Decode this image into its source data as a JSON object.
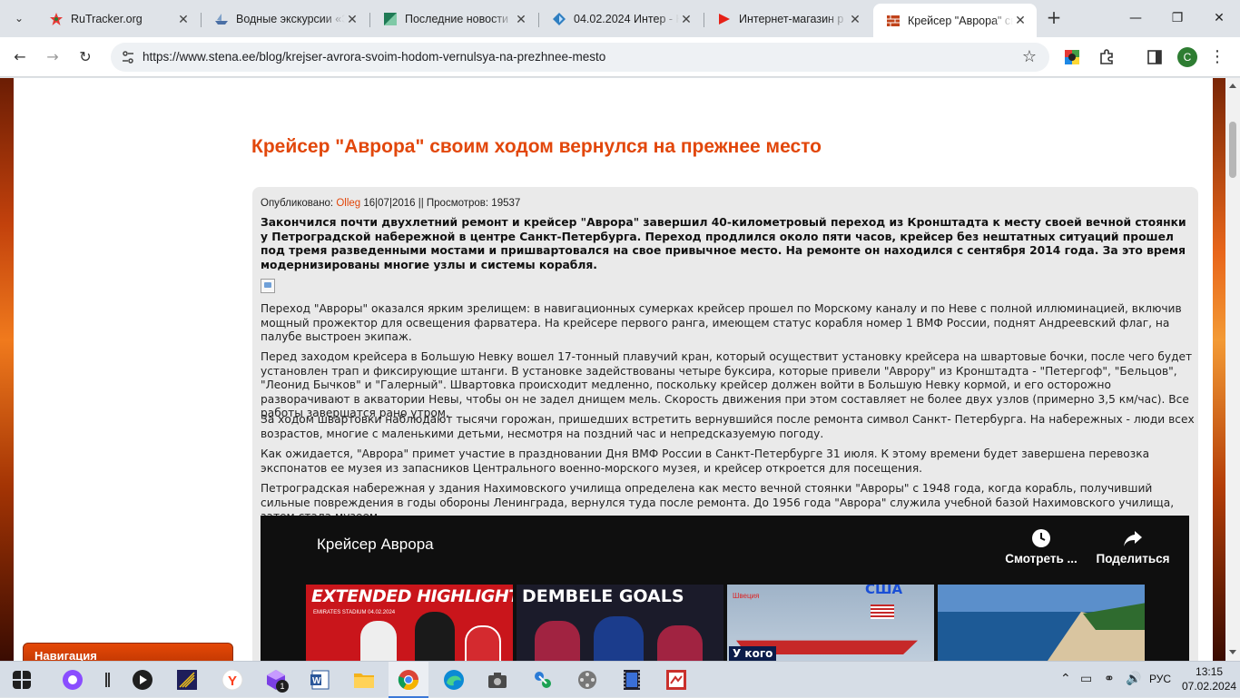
{
  "browser": {
    "tabs": [
      {
        "label": "RuTracker.org",
        "favicon_color": "#e53935"
      },
      {
        "label": "Водные экскурсии «Э",
        "favicon_color": "#4a6fa5"
      },
      {
        "label": "Последние новости",
        "favicon_color": "#1f7a55"
      },
      {
        "label": "04.02.2024 Интер - К",
        "favicon_color": "#2f7fc1"
      },
      {
        "label": "Интернет-магазин р",
        "favicon_color": "#e62117"
      },
      {
        "label": "Крейсер \"Аврора\" св",
        "favicon_color": "#c0431a"
      }
    ],
    "address": "https://www.stena.ee/blog/krejser-avrora-svoim-hodom-vernulsya-na-prezhnee-mesto",
    "profile_initial": "C",
    "profile_color": "#2e7d32"
  },
  "page": {
    "title": "Крейсер \"Аврора\" своим ходом вернулся на прежнее место",
    "meta": {
      "published_label": "Опубликовано: ",
      "author": "Olleg",
      "date_views": " 16|07|2016 || Просмотров: 19537"
    },
    "lead": "Закончился почти двухлетний ремонт и крейсер \"Аврора\" завершил 40-километровый переход из Кронштадта к месту своей вечной стоянки у Петроградской набережной в центре Санкт-Петербурга. Переход продлился около пяти часов, крейсер без нештатных ситуаций прошел под тремя разведенными мостами и пришвартовался на свое привычное место. На ремонте он находился с сентября 2014 года. За это время модернизированы многие узлы и системы корабля.",
    "paragraphs": [
      "Переход \"Авроры\" оказался ярким зрелищем: в навигационных сумерках крейсер прошел по Морскому каналу и по Неве с полной иллюминацией, включив мощный прожектор для освещения фарватера. На крейсере первого ранга, имеющем статус корабля номер 1 ВМФ России, поднят Андреевский флаг, на палубе выстроен экипаж.",
      "Перед заходом крейсера в Большую Невку вошел 17-тонный плавучий кран, который осуществит установку крейсера на швартовые бочки, после чего будет установлен трап и фиксирующие штанги. В установке задействованы четыре буксира, которые привели \"Аврору\" из Кронштадта - \"Петергоф\", \"Бельцов\", \"Леонид Бычков\" и \"Галерный\". Швартовка происходит медленно, поскольку крейсер должен войти в Большую Невку кормой, и его осторожно разворачивают в акватории Невы, чтобы он не задел днищем мель. Скорость движения при этом составляет не более двух узлов (примерно 3,5 км/час). Все работы завершатся рано утром.",
      "За ходом швартовки наблюдают тысячи горожан, пришедших встретить вернувшийся после ремонта символ Санкт- Петербурга. На набережных - люди всех возрастов, многие с маленькими детьми, несмотря на поздний час и непредсказуемую погоду.",
      "Как ожидается, \"Аврора\" примет участие в праздновании Дня ВМФ России в Санкт-Петербурге 31 июля. К этому времени будет завершена перевозка экспонатов ее музея из запасников Центрального военно-морского музея, и крейсер откроется для посещения.",
      "Петроградская набережная у здания Нахимовского училища определена как место вечной стоянки \"Авроры\" с 1948 года, когда корабль, получивший сильные повреждения в годы обороны Ленинграда, вернулся туда после ремонта. До 1956 года \"Аврора\" служила учебной базой Нахимовского училища, затем стала музеем."
    ],
    "video": {
      "title": "Крейсер Аврора",
      "watch_later": "Смотреть ...",
      "share": "Поделиться",
      "thumbs": [
        {
          "text": "EXTENDED HIGHLIGHTS",
          "sub": "EMIRATES STADIUM 04.02.2024",
          "bg": "#c9151b"
        },
        {
          "text": "DEMBELE GOALS",
          "bg": "#1b1b2a"
        },
        {
          "text": "США",
          "sub1": "Швеция",
          "sub2": "У кого",
          "bg": "#9fb3c8"
        },
        {
          "text": "",
          "bg": "#2d6aa8"
        }
      ]
    },
    "sidebar": {
      "nav_title": "Навигация"
    }
  },
  "taskbar": {
    "lang": "РУС",
    "time": "13:15",
    "date": "07.02.2024",
    "badge": "1"
  }
}
